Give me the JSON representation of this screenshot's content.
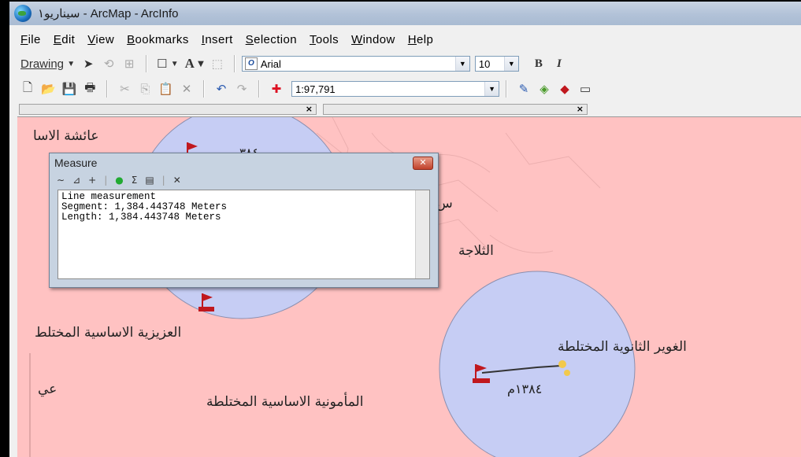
{
  "window": {
    "title": "سيناريو١ - ArcMap - ArcInfo"
  },
  "menu": [
    "File",
    "Edit",
    "View",
    "Bookmarks",
    "Insert",
    "Selection",
    "Tools",
    "Window",
    "Help"
  ],
  "toolbar_drawing": {
    "label": "Drawing",
    "font_name": "Arial",
    "font_size": "10",
    "bold": "B",
    "italic": "I"
  },
  "toolbar_standard": {
    "scale": "1:97,791"
  },
  "measure_window": {
    "title": "Measure",
    "lines": [
      "Line measurement",
      "Segment: 1,384.443748 Meters",
      "Length: 1,384.443748 Meters"
    ]
  },
  "map": {
    "labels": {
      "aisha": "عائشة الاسا",
      "thallaja": "الثلاجة",
      "sin": "س",
      "aziziya": "العزيزية الاساسية المختلط",
      "ghuwair": "الغوير الثانوية المختلطة",
      "mamuniya": "المأمونية الاساسية المختلطة",
      "distance": "١٣٨٤م",
      "ai": "عي",
      "small_number": "٣٨٤"
    },
    "colors": {
      "background": "#ffc2c2",
      "buffer": "#c6cdf4",
      "flag": "#c0181e",
      "point": "#f2c94c"
    }
  }
}
